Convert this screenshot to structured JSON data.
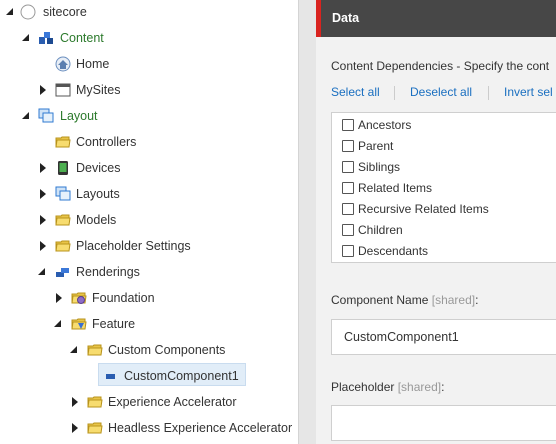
{
  "tree": {
    "items": [
      {
        "label": "sitecore",
        "icon": "sitecore-icon",
        "state": "expanded"
      },
      {
        "label": "Content",
        "icon": "content-icon",
        "state": "expanded"
      },
      {
        "label": "Home",
        "icon": "home-icon",
        "state": "leaf"
      },
      {
        "label": "MySites",
        "icon": "window-icon",
        "state": "collapsed"
      },
      {
        "label": "Layout",
        "icon": "layout-icon",
        "state": "expanded"
      },
      {
        "label": "Controllers",
        "icon": "folder-icon",
        "state": "leaf"
      },
      {
        "label": "Devices",
        "icon": "device-icon",
        "state": "collapsed"
      },
      {
        "label": "Layouts",
        "icon": "layouts-icon",
        "state": "collapsed"
      },
      {
        "label": "Models",
        "icon": "folder-icon",
        "state": "collapsed"
      },
      {
        "label": "Placeholder Settings",
        "icon": "folder-icon",
        "state": "collapsed"
      },
      {
        "label": "Renderings",
        "icon": "renderings-icon",
        "state": "expanded"
      },
      {
        "label": "Foundation",
        "icon": "module-folder-icon",
        "state": "collapsed"
      },
      {
        "label": "Feature",
        "icon": "module-folder-icon",
        "state": "expanded"
      },
      {
        "label": "Custom Components",
        "icon": "folder-icon",
        "state": "expanded"
      },
      {
        "label": "CustomComponent1",
        "icon": "rendering-icon",
        "state": "selected"
      },
      {
        "label": "Experience Accelerator",
        "icon": "folder-icon",
        "state": "collapsed"
      },
      {
        "label": "Headless Experience Accelerator",
        "icon": "folder-icon",
        "state": "collapsed"
      }
    ]
  },
  "section": {
    "title": "Data"
  },
  "dependencies": {
    "title": "Content Dependencies - Specify the cont",
    "links": [
      "Select all",
      "Deselect all",
      "Invert sel"
    ],
    "options": [
      "Ancestors",
      "Parent",
      "Siblings",
      "Related Items",
      "Recursive Related Items",
      "Children",
      "Descendants"
    ]
  },
  "component_name": {
    "label": "Component Name",
    "shared": "[shared]",
    "colon": ":",
    "value": "CustomComponent1"
  },
  "placeholder": {
    "label": "Placeholder",
    "shared": "[shared]",
    "colon": ":",
    "value": ""
  },
  "colors": {
    "accent_red": "#d9231f",
    "header_bg": "#474747",
    "link_blue": "#1a6fc0",
    "tree_green": "#2c7a2c"
  }
}
